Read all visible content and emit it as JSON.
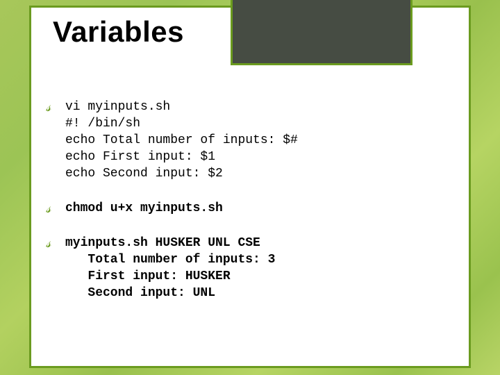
{
  "title": "Variables",
  "bullets": {
    "b1": {
      "l1": "vi myinputs.sh",
      "l2": "#! /bin/sh",
      "l3": "echo Total number of inputs: $#",
      "l4": "echo First input: $1",
      "l5": "echo Second input: $2"
    },
    "b2": {
      "l1": "chmod u+x myinputs.sh"
    },
    "b3": {
      "l1": "myinputs.sh HUSKER UNL CSE",
      "l2": "   Total number of inputs: 3",
      "l3": "   First input: HUSKER",
      "l4": "   Second input: UNL"
    }
  }
}
